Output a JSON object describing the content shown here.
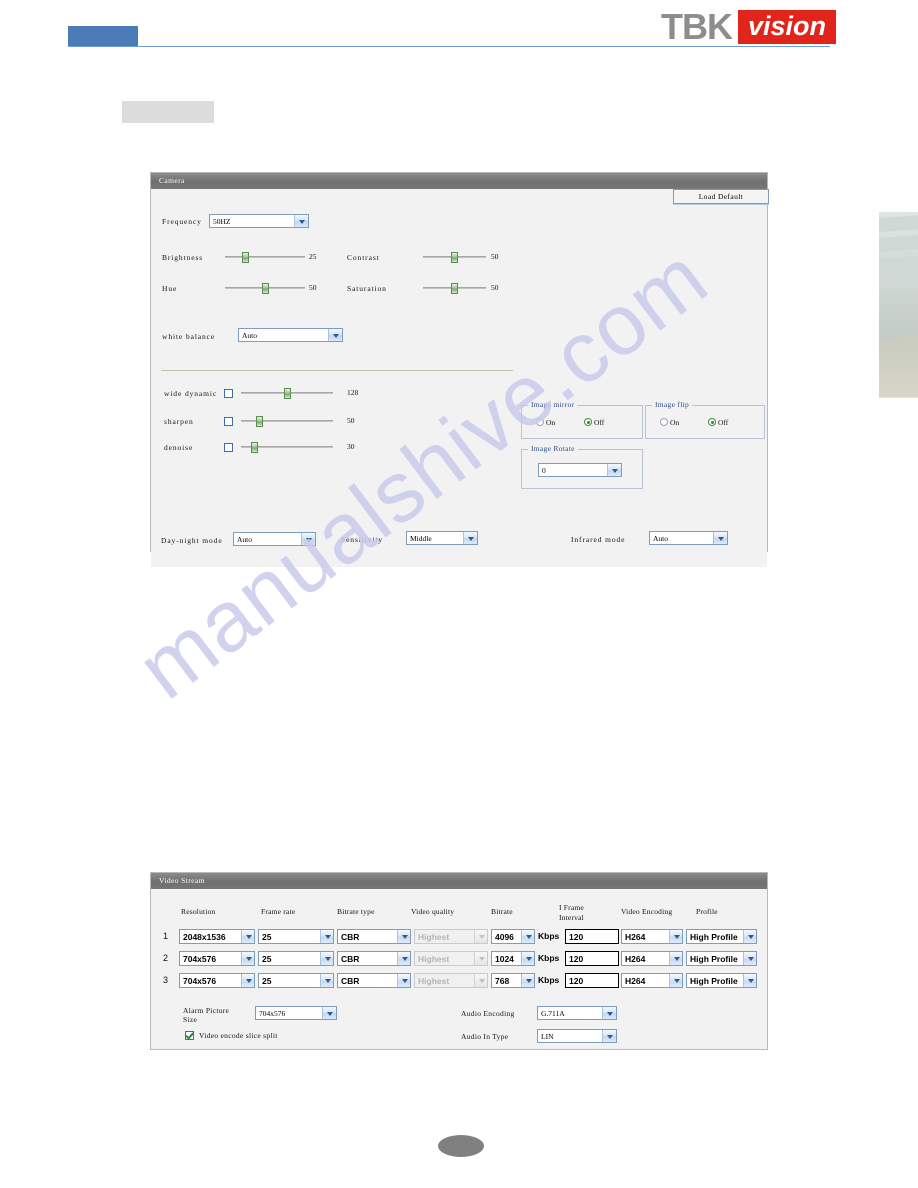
{
  "page": {
    "watermark": "manualshive.com",
    "brand": {
      "name_left": "TBK",
      "name_right": "vision"
    }
  },
  "camera_panel": {
    "title": "Camera",
    "load_default_label": "Load Default",
    "frequency": {
      "label": "Frequency",
      "value": "50HZ"
    },
    "sliders": [
      {
        "label": "Brightness",
        "value": "25",
        "percent": 25
      },
      {
        "label": "Contrast",
        "value": "50",
        "percent": 50
      },
      {
        "label": "Hue",
        "value": "50",
        "percent": 50
      },
      {
        "label": "Saturation",
        "value": "50",
        "percent": 50
      }
    ],
    "white_balance": {
      "label": "white balance",
      "value": "Auto"
    },
    "enhance": [
      {
        "label": "wide dynamic",
        "value": "128",
        "percent": 50,
        "checked": false
      },
      {
        "label": "sharpen",
        "value": "50",
        "percent": 20,
        "checked": false
      },
      {
        "label": "denoise",
        "value": "30",
        "percent": 15,
        "checked": false
      }
    ],
    "image_mirror": {
      "legend": "Image mirror",
      "on_label": "On",
      "off_label": "Off",
      "selected": "Off"
    },
    "image_flip": {
      "legend": "Image flip",
      "on_label": "On",
      "off_label": "Off",
      "selected": "Off"
    },
    "image_rotate": {
      "legend": "Image Rotate",
      "value": "0"
    },
    "bottom": {
      "day_night": {
        "label": "Day-night mode",
        "value": "Auto"
      },
      "sensitivity": {
        "label": "Sensitivity",
        "value": "Middle"
      },
      "infrared": {
        "label": "Infrared mode",
        "value": "Auto"
      }
    }
  },
  "stream_panel": {
    "title": "Video Stream",
    "headers": {
      "resolution": "Resolution",
      "frame_rate": "Frame rate",
      "bitrate_type": "Bitrate type",
      "video_quality": "Video quality",
      "bitrate": "Bitrate",
      "iframe": "I Frame\nInterval",
      "iframe_l1": "I Frame",
      "iframe_l2": "Interval",
      "video_encoding": "Video Encoding",
      "profile": "Profile"
    },
    "unit": "Kbps",
    "rows": [
      {
        "index": "1",
        "resolution": "2048x1536",
        "frame_rate": "25",
        "bitrate_type": "CBR",
        "video_quality": "Highest",
        "bitrate": "4096",
        "iframe_interval": "120",
        "video_encoding": "H264",
        "profile": "High Profile"
      },
      {
        "index": "2",
        "resolution": "704x576",
        "frame_rate": "25",
        "bitrate_type": "CBR",
        "video_quality": "Highest",
        "bitrate": "1024",
        "iframe_interval": "120",
        "video_encoding": "H264",
        "profile": "High Profile"
      },
      {
        "index": "3",
        "resolution": "704x576",
        "frame_rate": "25",
        "bitrate_type": "CBR",
        "video_quality": "Highest",
        "bitrate": "768",
        "iframe_interval": "120",
        "video_encoding": "H264",
        "profile": "High Profile"
      }
    ],
    "alarm_picture": {
      "label_l1": "Alarm Picture",
      "label_l2": "Size",
      "value": "704x576"
    },
    "slice_split": {
      "label": "Video encode slice split",
      "checked": true
    },
    "audio_encoding": {
      "label": "Audio Encoding",
      "value": "G.711A"
    },
    "audio_in_type": {
      "label": "Audio In Type",
      "value": "LIN"
    }
  }
}
